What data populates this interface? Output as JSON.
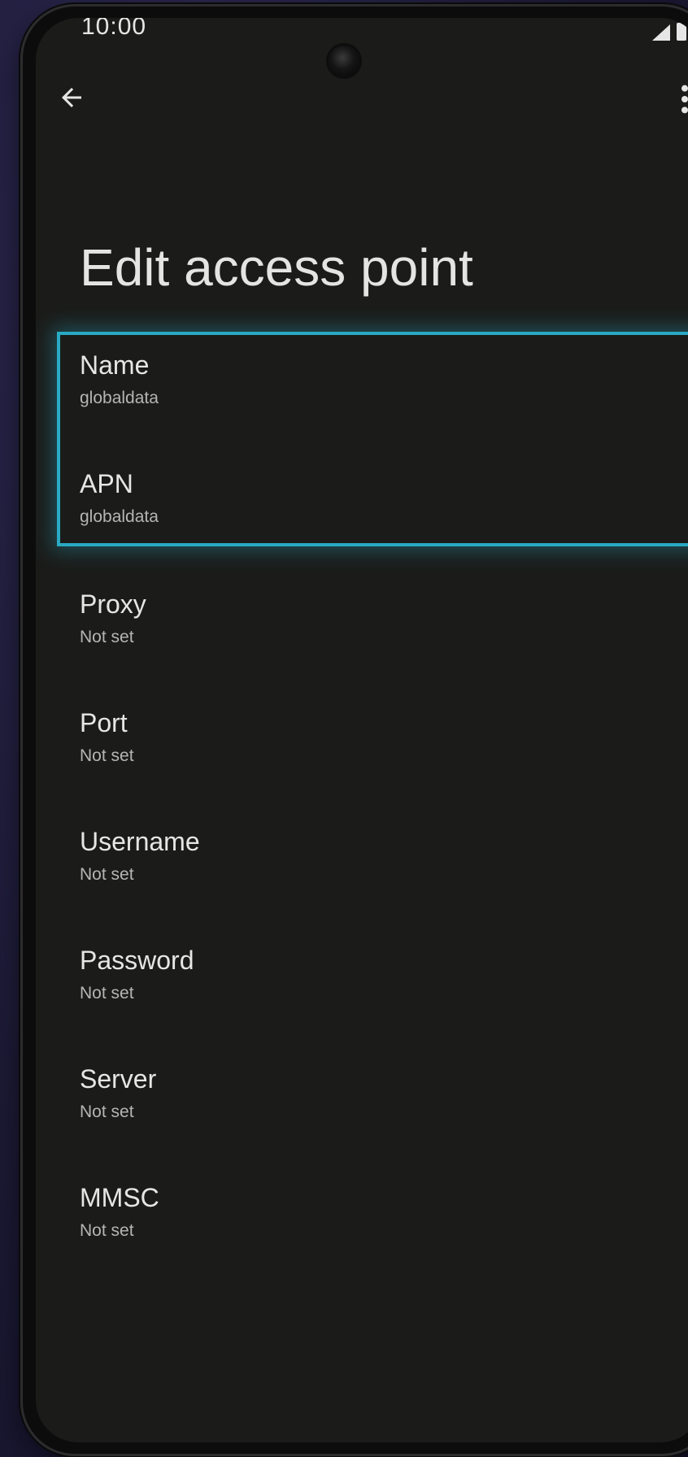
{
  "status_bar": {
    "time": "10:00"
  },
  "app_bar": {
    "back_icon": "arrow-back-icon",
    "menu_icon": "more-vert-icon"
  },
  "page": {
    "title": "Edit access point"
  },
  "settings": [
    {
      "label": "Name",
      "value": "globaldata"
    },
    {
      "label": "APN",
      "value": "globaldata"
    },
    {
      "label": "Proxy",
      "value": "Not set"
    },
    {
      "label": "Port",
      "value": "Not set"
    },
    {
      "label": "Username",
      "value": "Not set"
    },
    {
      "label": "Password",
      "value": "Not set"
    },
    {
      "label": "Server",
      "value": "Not set"
    },
    {
      "label": "MMSC",
      "value": "Not set"
    }
  ],
  "colors": {
    "highlight": "#29a9c4",
    "background": "#1b1c1a",
    "text_primary": "#e6e6e4",
    "text_secondary": "#b5b5b2"
  }
}
